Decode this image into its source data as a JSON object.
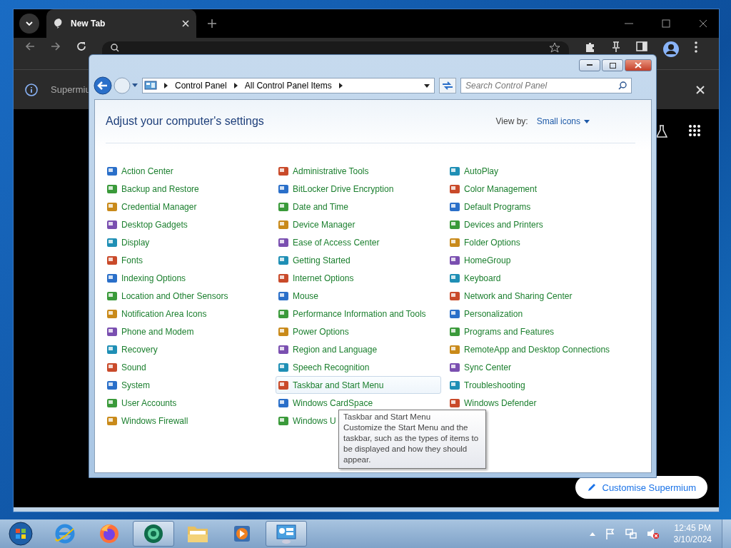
{
  "browser": {
    "tab": {
      "title": "New Tab"
    },
    "infobar": {
      "text": "Supermiu"
    },
    "customise_button": "Customise Supermium"
  },
  "control_panel": {
    "address": {
      "crumbs": [
        "Control Panel",
        "All Control Panel Items"
      ]
    },
    "search": {
      "placeholder": "Search Control Panel"
    },
    "heading": "Adjust your computer's settings",
    "view_by": {
      "label": "View by:",
      "value": "Small icons"
    },
    "columns": [
      [
        {
          "label": "Action Center",
          "hovered": false
        },
        {
          "label": "Backup and Restore",
          "hovered": false
        },
        {
          "label": "Credential Manager",
          "hovered": false
        },
        {
          "label": "Desktop Gadgets",
          "hovered": false
        },
        {
          "label": "Display",
          "hovered": false
        },
        {
          "label": "Fonts",
          "hovered": false
        },
        {
          "label": "Indexing Options",
          "hovered": false
        },
        {
          "label": "Location and Other Sensors",
          "hovered": false
        },
        {
          "label": "Notification Area Icons",
          "hovered": false
        },
        {
          "label": "Phone and Modem",
          "hovered": false
        },
        {
          "label": "Recovery",
          "hovered": false
        },
        {
          "label": "Sound",
          "hovered": false
        },
        {
          "label": "System",
          "hovered": false
        },
        {
          "label": "User Accounts",
          "hovered": false
        },
        {
          "label": "Windows Firewall",
          "hovered": false
        }
      ],
      [
        {
          "label": "Administrative Tools",
          "hovered": false
        },
        {
          "label": "BitLocker Drive Encryption",
          "hovered": false
        },
        {
          "label": "Date and Time",
          "hovered": false
        },
        {
          "label": "Device Manager",
          "hovered": false
        },
        {
          "label": "Ease of Access Center",
          "hovered": false
        },
        {
          "label": "Getting Started",
          "hovered": false
        },
        {
          "label": "Internet Options",
          "hovered": false
        },
        {
          "label": "Mouse",
          "hovered": false
        },
        {
          "label": "Performance Information and Tools",
          "hovered": false
        },
        {
          "label": "Power Options",
          "hovered": false
        },
        {
          "label": "Region and Language",
          "hovered": false
        },
        {
          "label": "Speech Recognition",
          "hovered": false
        },
        {
          "label": "Taskbar and Start Menu",
          "hovered": true
        },
        {
          "label": "Windows CardSpace",
          "hovered": false
        },
        {
          "label": "Windows U",
          "hovered": false
        }
      ],
      [
        {
          "label": "AutoPlay",
          "hovered": false
        },
        {
          "label": "Color Management",
          "hovered": false
        },
        {
          "label": "Default Programs",
          "hovered": false
        },
        {
          "label": "Devices and Printers",
          "hovered": false
        },
        {
          "label": "Folder Options",
          "hovered": false
        },
        {
          "label": "HomeGroup",
          "hovered": false
        },
        {
          "label": "Keyboard",
          "hovered": false
        },
        {
          "label": "Network and Sharing Center",
          "hovered": false
        },
        {
          "label": "Personalization",
          "hovered": false
        },
        {
          "label": "Programs and Features",
          "hovered": false
        },
        {
          "label": "RemoteApp and Desktop Connections",
          "hovered": false
        },
        {
          "label": "Sync Center",
          "hovered": false
        },
        {
          "label": "Troubleshooting",
          "hovered": false
        },
        {
          "label": "Windows Defender",
          "hovered": false
        }
      ]
    ],
    "tooltip": {
      "title": "Taskbar and Start Menu",
      "text": "Customize the Start Menu and the taskbar, such as the types of items to be displayed and how they should appear."
    }
  },
  "taskbar": {
    "apps": [
      {
        "kind": "ie",
        "active": false
      },
      {
        "kind": "firefox",
        "active": false
      },
      {
        "kind": "browser",
        "active": true
      },
      {
        "kind": "folder",
        "active": false
      },
      {
        "kind": "media",
        "active": false
      },
      {
        "kind": "control",
        "active": true
      }
    ],
    "clock": {
      "time": "12:45 PM",
      "date": "3/10/2024"
    }
  }
}
